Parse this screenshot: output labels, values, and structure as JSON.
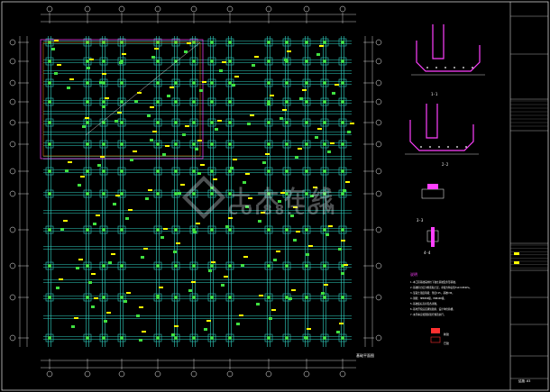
{
  "drawing": {
    "plan_title": "基础平面图",
    "watermark_cn": "土木在线",
    "watermark_en": "COI88.COM",
    "section_1_label": "1-1",
    "section_2_label": "2-2",
    "section_3_label": "3-3",
    "section_4_label": "4-4",
    "notes_title": "说明",
    "notes": [
      "1.本工程基础采用柱下独立基础及条形基础。",
      "2.基础持力层为粉质粘土层，承载力特征值fak=180kPa。",
      "3.混凝土强度等级：垫层C15，基础C30。",
      "4.钢筋：HPB300级，HRB400级。",
      "5.基础底标高详见各详图。",
      "6.基坑开挖后应通知勘察、设计单位验槽。",
      "7.未尽事宜按国家现行规范执行。"
    ],
    "legend_items": [
      "新建",
      "已建"
    ],
    "title_block_sheet": "结施-03"
  },
  "colors": {
    "background": "#000000",
    "beam": "#2fd0c0",
    "column": "#40e040",
    "dim": "#ffffff",
    "tag": "#ffff00",
    "detail": "#ff40ff",
    "frame": "#ffffff"
  }
}
